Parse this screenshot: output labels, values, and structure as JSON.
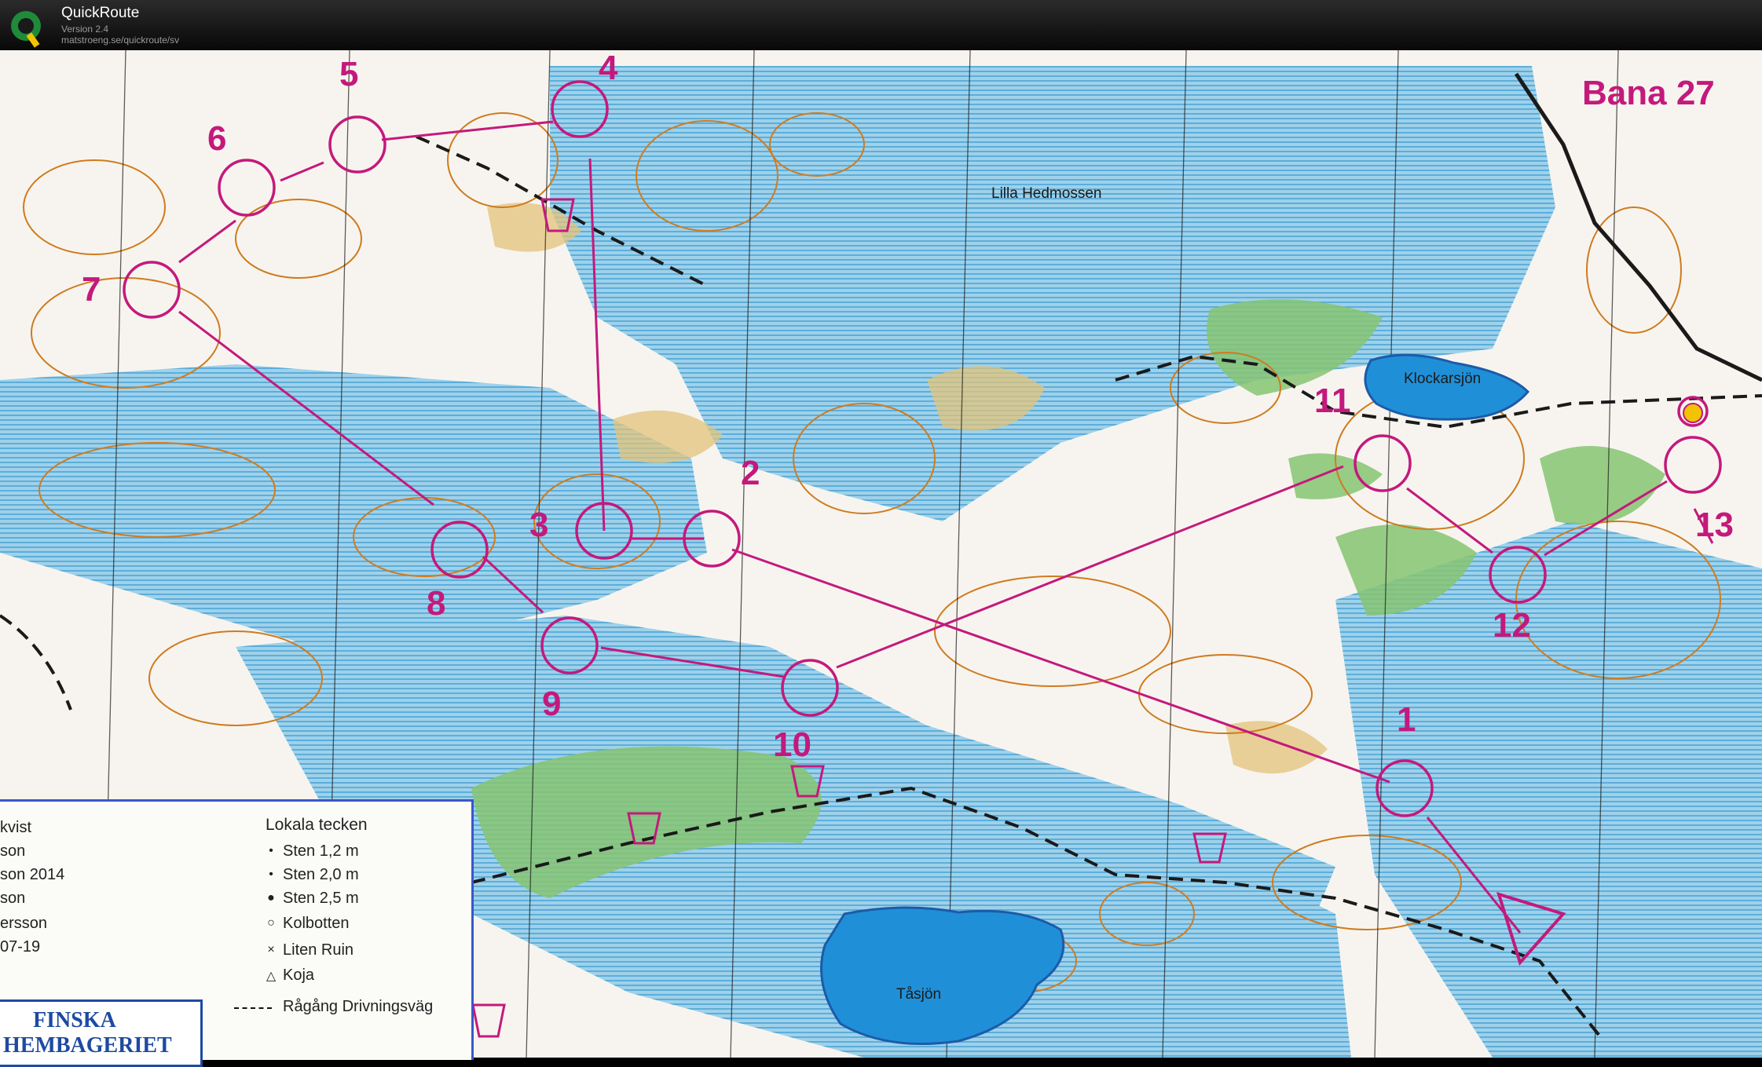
{
  "app": {
    "name": "QuickRoute",
    "version": "Version 2.4",
    "url": "matstroeng.se/quickroute/sv"
  },
  "map": {
    "course_label": "Bana 27",
    "places": {
      "lilla_hedmossen": "Lilla Hedmossen",
      "klockarsjon": "Klockarsjön",
      "tasjon": "Tåsjön"
    },
    "controls": [
      "1",
      "2",
      "3",
      "4",
      "5",
      "6",
      "7",
      "8",
      "9",
      "10",
      "11",
      "12",
      "13"
    ],
    "colors": {
      "course": "#c4197c",
      "water": "#1f90d8",
      "marsh": "#8ecbe8",
      "forest_green": "#7fc06a",
      "contour": "#cf7b1e"
    }
  },
  "legend": {
    "credits": [
      "kvist",
      "son",
      "son  2014",
      "son",
      "ersson",
      "07-19"
    ],
    "title": "Lokala tecken",
    "items": [
      "Sten 1,2 m",
      "Sten 2,0 m",
      "Sten 2,5 m",
      "Kolbotten",
      "Liten Ruin",
      "Koja",
      "Rågång Drivningsväg"
    ],
    "symbols": [
      "•",
      "•",
      "●",
      "○",
      "×",
      "△"
    ]
  },
  "sponsor": {
    "line1": "FINSKA",
    "line2": "HEMBAGERIET"
  }
}
